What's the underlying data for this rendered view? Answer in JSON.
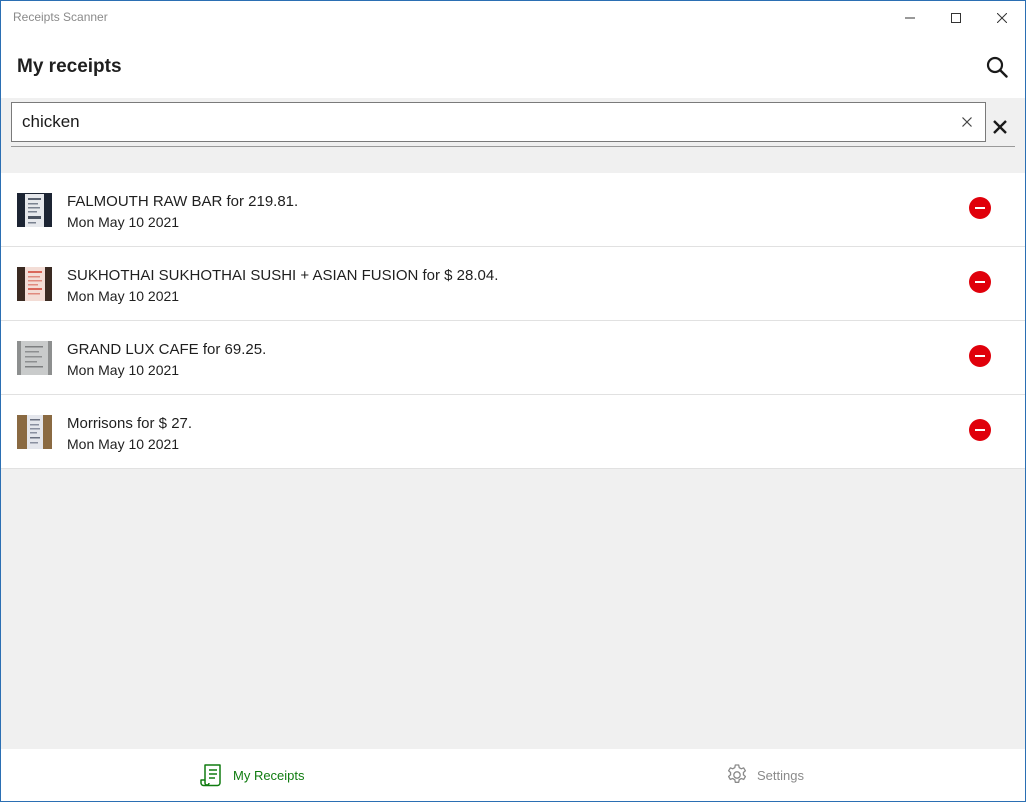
{
  "window": {
    "title": "Receipts Scanner",
    "accent_color": "#107c10",
    "delete_color": "#e0000b"
  },
  "header": {
    "title": "My receipts",
    "search_icon": "search-icon"
  },
  "search": {
    "value": "chicken",
    "clear_icon": "clear-icon",
    "close_icon": "close-icon"
  },
  "receipts": [
    {
      "title": "FALMOUTH RAW BAR for 219.81.",
      "date": "Mon May 10 2021",
      "thumb": "receipt-photo-dark"
    },
    {
      "title": "SUKHOTHAI SUKHOTHAI SUSHI + ASIAN FUSION for $ 28.04.",
      "date": "Mon May 10 2021",
      "thumb": "receipt-photo-red"
    },
    {
      "title": "GRAND LUX CAFE for 69.25.",
      "date": "Mon May 10 2021",
      "thumb": "receipt-photo-gray"
    },
    {
      "title": "Morrisons for $ 27.",
      "date": "Mon May 10 2021",
      "thumb": "receipt-photo-wood"
    }
  ],
  "nav": {
    "receipts_label": "My Receipts",
    "settings_label": "Settings",
    "receipts_icon": "receipt-icon",
    "settings_icon": "gear-icon"
  }
}
